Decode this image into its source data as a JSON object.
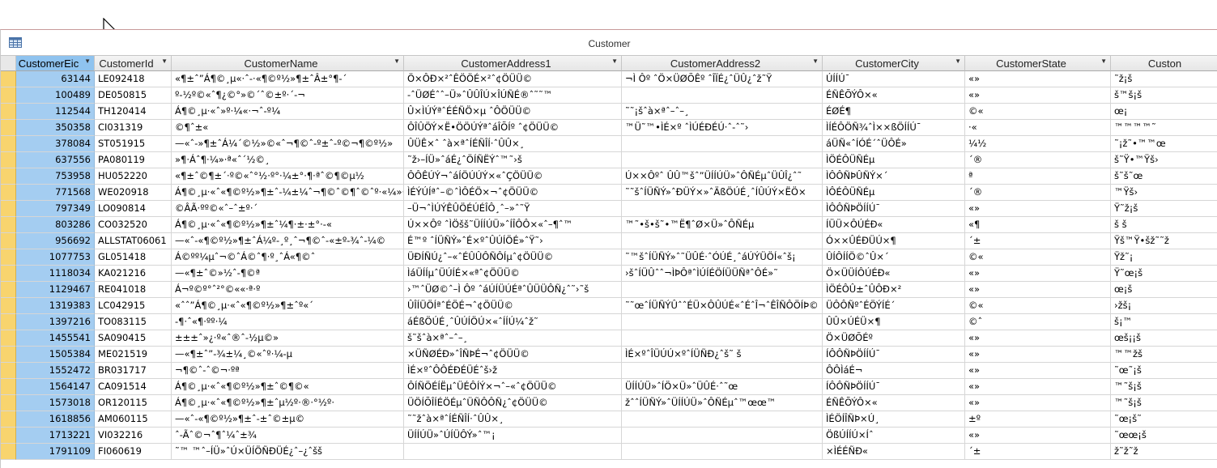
{
  "window": {
    "title": "Customer"
  },
  "columns": [
    {
      "label": "CustomerEic"
    },
    {
      "label": "CustomerId"
    },
    {
      "label": "CustomerName"
    },
    {
      "label": "CustomerAddress1"
    },
    {
      "label": "CustomerAddress2"
    },
    {
      "label": "CustomerCity"
    },
    {
      "label": "CustomerState"
    },
    {
      "label": "Custon"
    }
  ],
  "rows": [
    [
      "63144",
      "LE092418",
      "«¶±ˆ”Á¶©¸µ«·ˆ-·«¶©º½»¶±ˆÂ±°¶-´",
      "Ö×ÔÐ×²ˆÊÖÖÉ×²ˆ¢ÖÜÜ©",
      "¬Ì Ôº ˆÖ×ÜØÕÊº ˆÎÏÉ¿ˆÜÛ¿ˆž˜Ÿ",
      "ÚÍÍÚˉ",
      "«»",
      "˜ž¡š"
    ],
    [
      "100489",
      "DE050815",
      "º-½º©«ˆ¶¿©°»©´ˆ©±º·´-¬",
      "-ˆÜØÉˆˆ–Ü»ˆÛÛÎÚ×ÎÚÑÉ®ˆ˜˜™",
      "",
      "ÉÑÊÕÝÔ×«",
      "«»",
      "š™š¡š"
    ],
    [
      "112544",
      "TH120414",
      "Á¶©¸µ·«ˆ»º·¼«·¬ˆ-º¼",
      "Û×ÌÚÝªˆÉÉÑÖ×µ ˆÔÖÜÜ©",
      "˜˜¡šˆà×ªˆ–ˆ–¸",
      "ÉØÉ¶",
      "©«",
      "œ¡"
    ],
    [
      "350358",
      "CI031319",
      "©¶ˆ±«",
      "ÔÎÛÖÝ×Ë•ÖÖÚÝªˆáÎÕÍº ˆ¢ÖÜÜ©",
      "™Ü˜™•ÌÉ×º ˆÌÚÉÐÉÚ·ˆ-ˆ˜›",
      "ÌÍÉÔÖÑ¾ˆÌ××ßÖÍÍÚˉ",
      "·«",
      "™™™™˜"
    ],
    [
      "378084",
      "ST051915",
      "—«ˆ-»¶±ˆÁ¼´©½»©«ˆ¬¶©ˆ-º±ˆ-º©¬¶©º½»",
      "ÛÜÊ×ˆ ˆà×ªˆÍÉÑÎÍ·ˆÛÛ×¸",
      "",
      "áÜÑ«ˆÍÓÉ´ˆÜÔÉ»",
      "¼½",
      "˜¡ž˜•™™œ"
    ],
    [
      "637556",
      "PA080119",
      "»¶·Áˆ¶·¼»·ª«ˆ´½©¸",
      "˜ž›–ÍÜ»ˆáÉ¿ˆÖÍÑËÝˆ™˜›š",
      "",
      "ÌÖÉÔÜÑÉµ",
      "´®",
      "š˜Ÿ•™Ÿš›"
    ],
    [
      "753958",
      "HU052220",
      "«¶±ˆ©¶±´·º©«ˆ°½·º°·¼±°·¶·ªˆ©¶©µ½",
      "ÔÔÊÚÝ¬ˆáÍÖÚÚÝ×«ˆÇÖÜÜ©",
      "Ú××Ôºˆ ÛÛ™šˆ”ÜÍÍÚÜ»ˆÔÑÉµˆÜÛÎ¿ˆ˜",
      "ÌÔÔÑÞÛÑÝ×´",
      "ª",
      "š˜š˜œ"
    ],
    [
      "771568",
      "WE020918",
      "Á¶©¸µ·«ˆ«¶©º½»¶±ˆ-¼±¼ˆ¬¶©ˆ©¶ˆ©ˆº·«¼»·¿",
      "ÌÉÝÚÍªˆ–©ˆÌÔÉÖ×¬ˆ¢ÖÜÜ©",
      "˜˜šˆÍÜÑÝ»ˆÐÜÝ×»ˆÄßÖÚÉ¸ˆÍÛÚÝ×ËÖ×",
      "ÌÔÉÔÜÑÉµ",
      "´®",
      "™Ÿš›"
    ],
    [
      "797349",
      "LO090814",
      "©ÂÃ·ºº©«ˆ–ˆ±º·´",
      "–Ü¬ˆÌÚÝÊÛÖÉÚÉÎÔ¸ˆ–»ˆ˜Ÿ",
      "",
      "ÌÔÔÑÞÖÍÍÚˉ",
      "«»",
      "Ÿ˜ž¡š"
    ],
    [
      "803286",
      "CO032520",
      "Á¶©¸µ·«ˆ«¶©º½»¶±ˆ¼¶·±·±°·-«",
      "Ú××Ôº ˆÌÖšš˜ÜÍÍÚÜ»ˆÍÎÔÔ×«ˆ–¶ˆ™",
      "™˜•š•š˜•™Ë¶ˆØ×Ü»ˆÔÑÉµ",
      "ÍÜÜ×ÔÚÉÐ«",
      "«¶",
      "š š"
    ],
    [
      "956692",
      "ALLSTAT06061",
      "—«ˆ-«¶©º½»¶±ˆÁ¼º-¸º¸ˆ¬¶©ˆ-«±º-¾ˆ-¼©",
      "É™º ˆÍÜÑÝ»ˆÉ×ºˆÛÚÍÖÉ»ˆŸ˜›",
      "",
      "Ó××ÛÉÐÜÚ×¶",
      "´±",
      "Ÿš™Ÿ•šž˜˜ž"
    ],
    [
      "1077753",
      "GL051418",
      "Á©ºº¼µˆ¬©ˆÁ©ˆ¶·º¸ˆÁ«¶©ˆ",
      "ÜÐÍÑÚ¿ˆ–«ˆÉÛÛÔÑÔÍµˆ¢ÖÜÜ©",
      "˜™šˆÍÜÑÝ»ˆ˜ÜÛÉ·ˆÓÚÉ¸ˆáÚÝÜÖÍ«ˆš¡",
      "ÛÍÔÍÍÖ©ˆÛ×´",
      "©«",
      "Ÿž˜¡"
    ],
    [
      "1118034",
      "KA021216",
      "—«¶±ˆ©»½ˆ-¶©ª",
      "ÌáÜÍÍµˆÜÚÍÉ×«ªˆ¢ÖÜÜ©",
      "›šˆÍÜÛˆˆ¬ÌÞÔªˆÌÚÍÉÖÍÜÜÑªˆÔÉ»˜",
      "Ö×ÜÜÍÔÚÉÐ«",
      "«»",
      "Ÿ˜œ¡š"
    ],
    [
      "1129467",
      "RE041018",
      "Á¬º©º°ˆ²°©««·ª·º",
      "›™ˆÜØ©ˆ–Ì Ôº ˆáÚÍÜÚÉªˆÛÜÜÔÑ¿ˆ˜›˜š",
      "",
      "ÌÖÉÔÛ±ˆÛÔÐ×²",
      "«»",
      "œ¡š"
    ],
    [
      "1319383",
      "LC042915",
      "«ˆˆ”Á¶©¸µ·«ˆ«¶©º½»¶±ˆº«´",
      "ÛÎÍÜÖÍªˆÉÖÉ¬ˆ¢ÖÜÜ©",
      "˜˜œˆÍÜÑÝÛˆˆÉÜ×ÔÛÚÉ«ˆÉˆÎ¬ˆÊÎÑÔÖÍÞ©",
      "ÜÔÔÑºˆÉÖÝÍÉ´",
      "©«",
      "›žš¡"
    ],
    [
      "1397216",
      "TO083115",
      "-¶·ˆ«¶·ºº·¼",
      "áÉßÖÚÉ¸ˆÛÚÍÖÚ×«ˆÍÍÚ¼ˆž˜",
      "",
      "ÛÛ×ÚÉÜ×¶",
      "©ˆ",
      "š¡™"
    ],
    [
      "1455541",
      "SA090415",
      "±±±ˆ»¿·º«ˆ®ˆ-½µ©»",
      "š˜šˆà×ªˆ–ˆ–¸",
      "",
      "Ö×ÜØÕÉº",
      "«»",
      "œš¡¡š"
    ],
    [
      "1505384",
      "ME021519",
      "—«¶±ˆ”-¾±¼¸©«ˆº·¼-µ",
      "×ÜÑØÉÐ»ˆÎÑÞÉ¬ˆ¢ÖÜÜ©",
      "ÌÉ×ºˆÎÜÚÚ×ºˆÍÜÑÐ¿ˆš˜ š",
      "ÍÔÔÑÞÖÍÍÚˉ",
      "«»",
      "™™žš"
    ],
    [
      "1552472",
      "BR031717",
      "¬¶©ˆ-ˆ©¬·ºª",
      "ÌÉ×ºˆÔÔÉÐÉÜÉˆš›ž",
      "",
      "ÔÔÌáÉ¬",
      "«»",
      "˜œ˜¡š"
    ],
    [
      "1564147",
      "CA091514",
      "Á¶©¸µ·«ˆ«¶©º½»¶±ˆ©¶©«",
      "ÔÍÑÖÉÍËµˆÜÉÔÍÝ×¬ˆ–«ˆ¢ÖÜÜ©",
      "ÜÍÍÚÜ»ˆÍÖ×Ü»ˆÜÛÉ·ˆ˜œ",
      "ÍÔÔÑÞÖÍÍÚˉ",
      "«»",
      "™˜š¡š"
    ],
    [
      "1573018",
      "OR120115",
      "Á¶©¸µ·«ˆ«¶©º½»¶±ˆµ½º·®·°½º·",
      "ÜÖÍÕÎÍÉÖÉµˆÜÑÔÔÑ¿ˆ¢ÖÜÜ©",
      "žˆˆÍÜÑÝ»ˆÜÍÍÚÜ»ˆÔÑÉµˆ™œœ™",
      "ÉÑÊÕÝÔ×«",
      "«»",
      "™˜š¡š"
    ],
    [
      "1618856",
      "AM060115",
      "—«ˆ-«¶©º½»¶±ˆ-±ˆ©±µ©",
      "˜˜žˆà×ªˆÍÉÑÎÍ·ˆÛÛ×¸",
      "",
      "ÌÉÖÍÎÑÞ×Ú¸",
      "±º",
      "˜œ¡š˜"
    ],
    [
      "1713221",
      "VI032216",
      "ˆ-Ãˆ©¬ˆ¶ˆ¼ˆ±¾",
      "ÜÍÍÚÜ»ˆÚÍÜÔÝ»ˆ™¡",
      "",
      "ÖßÚÍÍÚ×Íˆ",
      "«»",
      "˜œœ¡š"
    ],
    [
      "1791109",
      "FI060619",
      "˜™ ™ˆ–ÍÜ»ˆÚ×ÜÍÖÑÐÜÉ¿ˆ–¿ˆšš",
      "",
      "",
      "×ÌÉÉÑÐ«",
      "´±",
      "ž˜ž˜ž"
    ]
  ]
}
